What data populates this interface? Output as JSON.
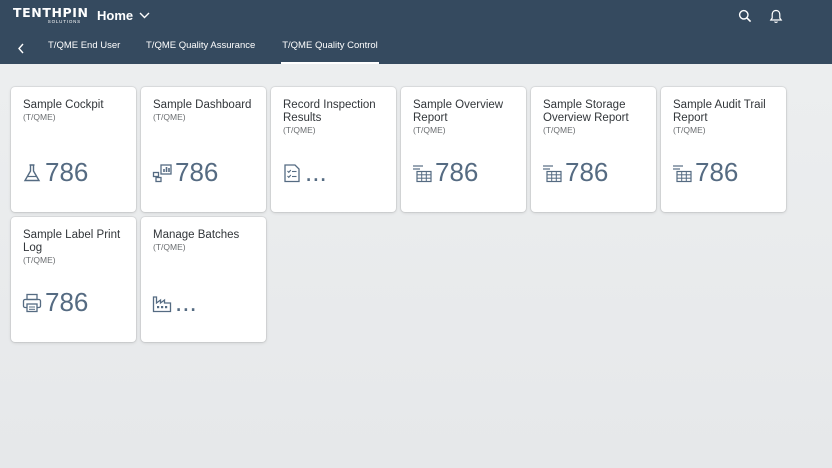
{
  "shell": {
    "logo_text": "TENTHPIN",
    "logo_sub": "SOLUTIONS",
    "home_label": "Home",
    "icons": [
      "search-icon",
      "bell-icon"
    ]
  },
  "nav": {
    "tabs": [
      {
        "label": "T/QME End User"
      },
      {
        "label": "T/QME Quality Assurance"
      },
      {
        "label": "T/QME Quality Control",
        "active": true
      }
    ]
  },
  "tiles": [
    {
      "title": "Sample Cockpit",
      "subtitle": "(T/QME)",
      "icon": "flask-icon",
      "value": "786"
    },
    {
      "title": "Sample Dashboard",
      "subtitle": "(T/QME)",
      "icon": "dashboard-icon",
      "value": "786"
    },
    {
      "title": "Record Inspection Results",
      "subtitle": "(T/QME)",
      "icon": "checklist-icon",
      "value": "..."
    },
    {
      "title": "Sample Overview Report",
      "subtitle": "(T/QME)",
      "icon": "table-report-icon",
      "value": "786"
    },
    {
      "title": "Sample Storage Overview Report",
      "subtitle": "(T/QME)",
      "icon": "table-report-icon",
      "value": "786"
    },
    {
      "title": "Sample Audit Trail Report",
      "subtitle": "(T/QME)",
      "icon": "table-report-icon",
      "value": "786"
    },
    {
      "title": "Sample Label Print Log",
      "subtitle": "(T/QME)",
      "icon": "printer-icon",
      "value": "786"
    },
    {
      "title": "Manage Batches",
      "subtitle": "(T/QME)",
      "icon": "factory-icon",
      "value": "..."
    }
  ],
  "colors": {
    "shell_bg": "#354a5f",
    "kpi": "#556b82",
    "icon": "#556b82"
  }
}
